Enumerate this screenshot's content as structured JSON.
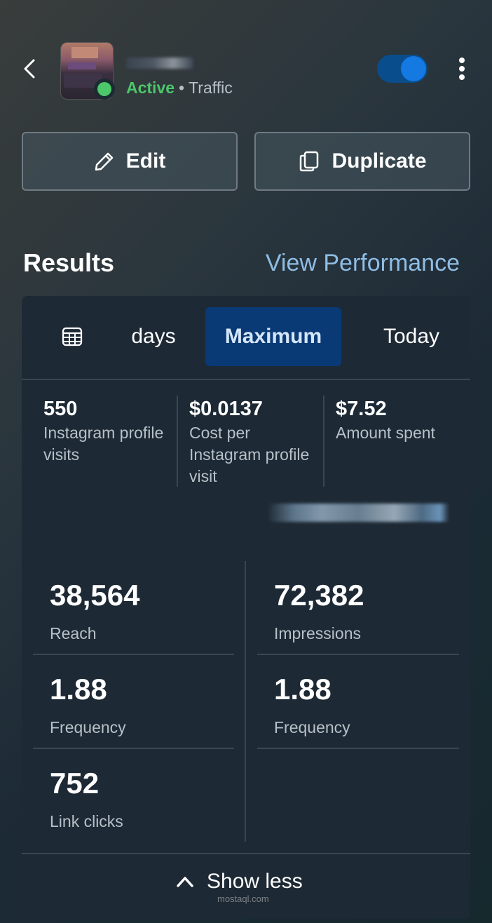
{
  "header": {
    "status": "Active",
    "separator": "•",
    "objective": "Traffic",
    "toggle_on": true
  },
  "actions": {
    "edit_label": "Edit",
    "duplicate_label": "Duplicate"
  },
  "results": {
    "title": "Results",
    "view_performance": "View Performance"
  },
  "date_tabs": {
    "days_label": "days",
    "maximum_label": "Maximum",
    "today_label": "Today",
    "selected": "Maximum"
  },
  "summary": [
    {
      "value": "550",
      "label": "Instagram profile visits"
    },
    {
      "value": "$0.0137",
      "label": "Cost per Instagram profile visit"
    },
    {
      "value": "$7.52",
      "label": "Amount spent"
    }
  ],
  "metrics": {
    "reach": {
      "value": "38,564",
      "label": "Reach"
    },
    "impressions": {
      "value": "72,382",
      "label": "Impressions"
    },
    "frequency_left": {
      "value": "1.88",
      "label": "Frequency"
    },
    "frequency_right": {
      "value": "1.88",
      "label": "Frequency"
    },
    "link_clicks": {
      "value": "752",
      "label": "Link clicks"
    }
  },
  "footer": {
    "show_less": "Show less"
  },
  "watermark": "mostaql.com",
  "colors": {
    "active_green": "#4cc76a",
    "link_blue": "#8fbde4",
    "toggle_blue": "#1479e0",
    "selected_tab_bg": "#0a3a75",
    "card_bg": "#1d2934"
  }
}
